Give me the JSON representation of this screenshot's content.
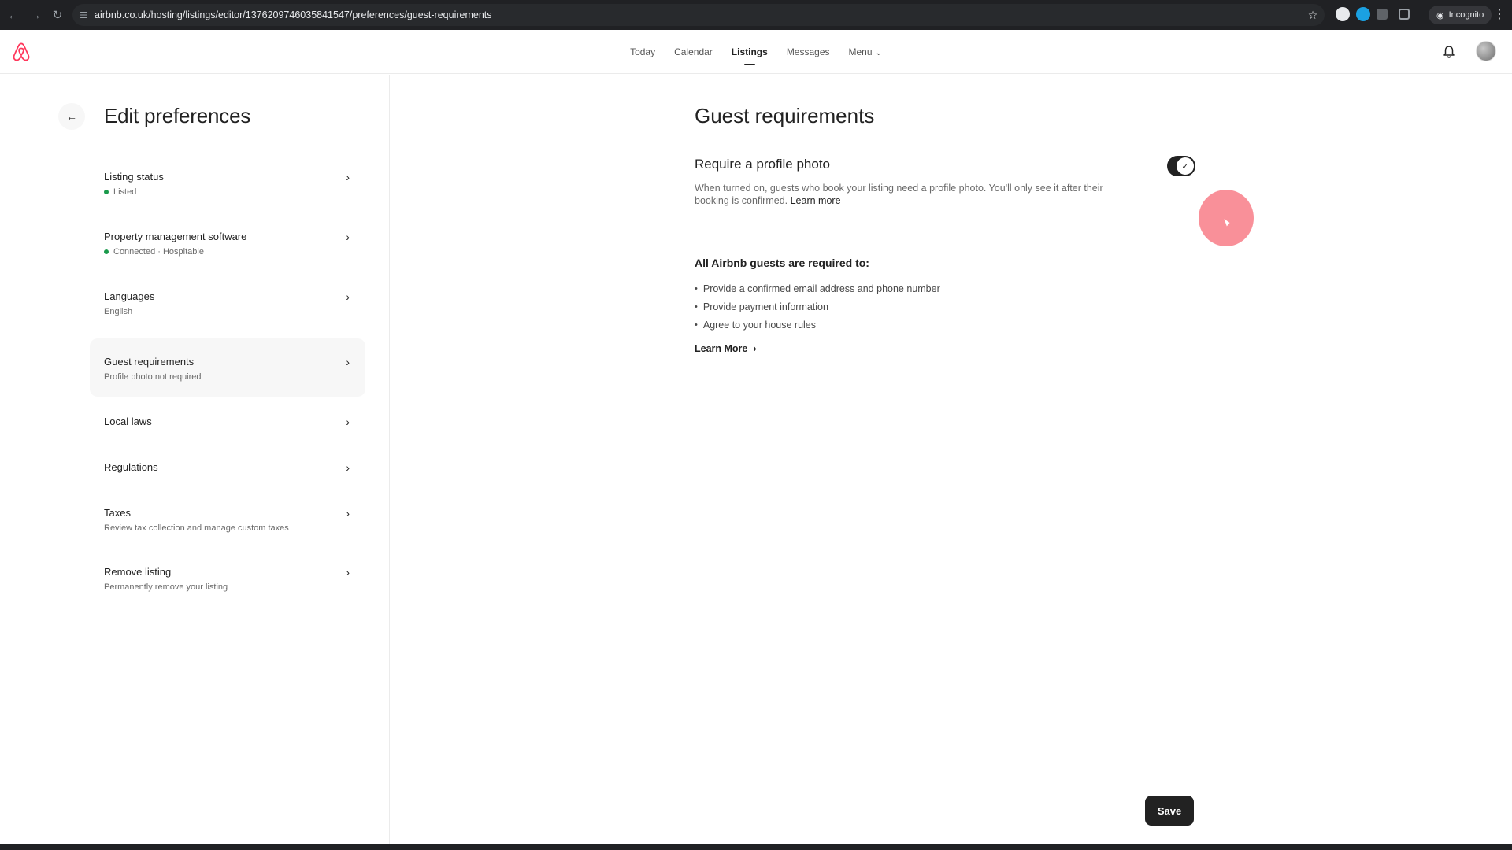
{
  "browser": {
    "url": "airbnb.co.uk/hosting/listings/editor/1376209746035841547/preferences/guest-requirements",
    "profile_label": "Incognito",
    "icons": [
      "back-icon",
      "forward-icon",
      "reload-icon",
      "site-settings-icon",
      "bookmark-star-icon",
      "extension-icon",
      "incognito-icon",
      "browser-menu-icon"
    ]
  },
  "header": {
    "nav": [
      {
        "label": "Today"
      },
      {
        "label": "Calendar"
      },
      {
        "label": "Listings",
        "active": true
      },
      {
        "label": "Messages"
      },
      {
        "label": "Menu"
      }
    ],
    "brand_color": "#ff385c"
  },
  "sidebar": {
    "title": "Edit preferences",
    "items": [
      {
        "label": "Listing status",
        "sub": "Listed",
        "status_dot": true
      },
      {
        "label": "Property management software",
        "sub": "Connected · Hospitable",
        "status_dot": true
      },
      {
        "label": "Languages",
        "sub": "English"
      },
      {
        "label": "Guest requirements",
        "sub": "Profile photo not required",
        "selected": true
      },
      {
        "label": "Local laws"
      },
      {
        "label": "Regulations"
      },
      {
        "label": "Taxes",
        "sub": "Review tax collection and manage custom taxes"
      },
      {
        "label": "Remove listing",
        "sub": "Permanently remove your listing"
      }
    ],
    "status_color": "#1a9a4b"
  },
  "main": {
    "title": "Guest requirements",
    "setting": {
      "title": "Require a profile photo",
      "description": "When turned on, guests who book your listing need a profile photo. You'll only see it after their booking is confirmed.",
      "link": "Learn more",
      "toggle_on": true
    },
    "requirements_heading": "All Airbnb guests are required to:",
    "requirements": [
      "Provide a confirmed email address and phone number",
      "Provide payment information",
      "Agree to your house rules"
    ],
    "learn_more": "Learn More"
  },
  "footer": {
    "save_label": "Save"
  }
}
